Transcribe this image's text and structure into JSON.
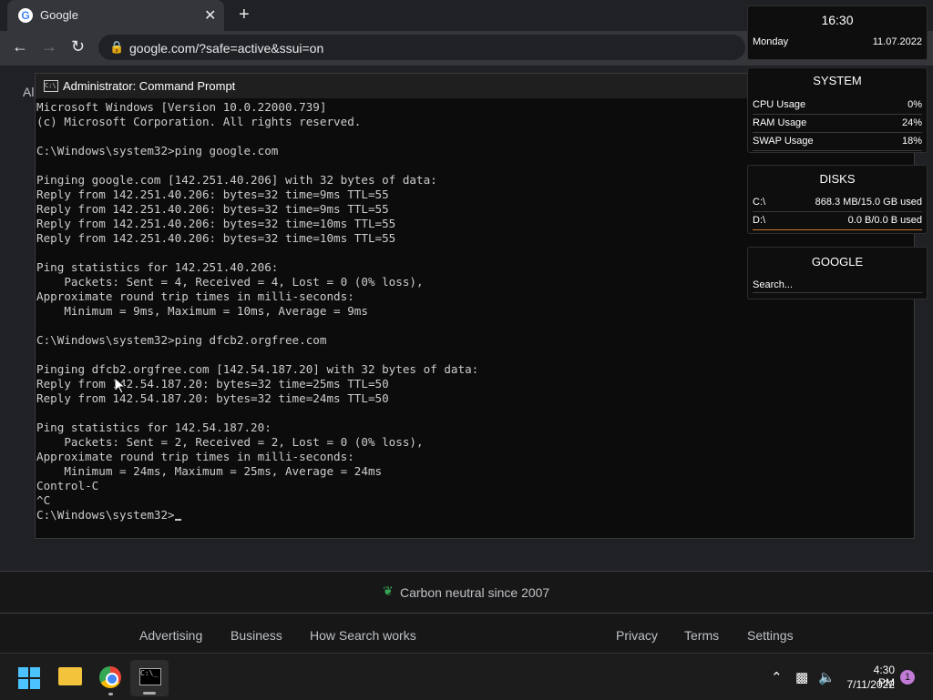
{
  "browser": {
    "tab_title": "Google",
    "favicon_letter": "G",
    "tab_close": "✕",
    "new_tab": "+",
    "url": "google.com/?safe=active&ssui=on",
    "back": "←",
    "forward": "→",
    "reload": "↻"
  },
  "page": {
    "partial_text": "Al",
    "carbon_text": "Carbon neutral since 2007",
    "footer_left": [
      "Advertising",
      "Business",
      "How Search works"
    ],
    "footer_right": [
      "Privacy",
      "Terms",
      "Settings"
    ]
  },
  "cmd": {
    "title": "Administrator: Command Prompt",
    "icon_text": "C:\\",
    "lines": [
      "Microsoft Windows [Version 10.0.22000.739]",
      "(c) Microsoft Corporation. All rights reserved.",
      "",
      "C:\\Windows\\system32>ping google.com",
      "",
      "Pinging google.com [142.251.40.206] with 32 bytes of data:",
      "Reply from 142.251.40.206: bytes=32 time=9ms TTL=55",
      "Reply from 142.251.40.206: bytes=32 time=9ms TTL=55",
      "Reply from 142.251.40.206: bytes=32 time=10ms TTL=55",
      "Reply from 142.251.40.206: bytes=32 time=10ms TTL=55",
      "",
      "Ping statistics for 142.251.40.206:",
      "    Packets: Sent = 4, Received = 4, Lost = 0 (0% loss),",
      "Approximate round trip times in milli-seconds:",
      "    Minimum = 9ms, Maximum = 10ms, Average = 9ms",
      "",
      "C:\\Windows\\system32>ping dfcb2.orgfree.com",
      "",
      "Pinging dfcb2.orgfree.com [142.54.187.20] with 32 bytes of data:",
      "Reply from 142.54.187.20: bytes=32 time=25ms TTL=50",
      "Reply from 142.54.187.20: bytes=32 time=24ms TTL=50",
      "",
      "Ping statistics for 142.54.187.20:",
      "    Packets: Sent = 2, Received = 2, Lost = 0 (0% loss),",
      "Approximate round trip times in milli-seconds:",
      "    Minimum = 24ms, Maximum = 25ms, Average = 24ms",
      "Control-C",
      "^C",
      "C:\\Windows\\system32>"
    ]
  },
  "widgets": {
    "clock": {
      "time": "16:30",
      "day": "Monday",
      "date": "11.07.2022"
    },
    "system": {
      "title": "SYSTEM",
      "rows": [
        {
          "label": "CPU Usage",
          "value": "0%"
        },
        {
          "label": "RAM Usage",
          "value": "24%"
        },
        {
          "label": "SWAP Usage",
          "value": "18%"
        }
      ]
    },
    "disks": {
      "title": "DISKS",
      "rows": [
        {
          "label": "C:\\",
          "value": "868.3 MB/15.0 GB used"
        },
        {
          "label": "D:\\",
          "value": "0.0 B/0.0 B used"
        }
      ]
    },
    "google": {
      "title": "GOOGLE",
      "search": "Search..."
    }
  },
  "taskbar": {
    "time": "4:30 PM",
    "date": "7/11/2022",
    "notifications": "1",
    "cmd_icon_text": "C:\\_"
  }
}
